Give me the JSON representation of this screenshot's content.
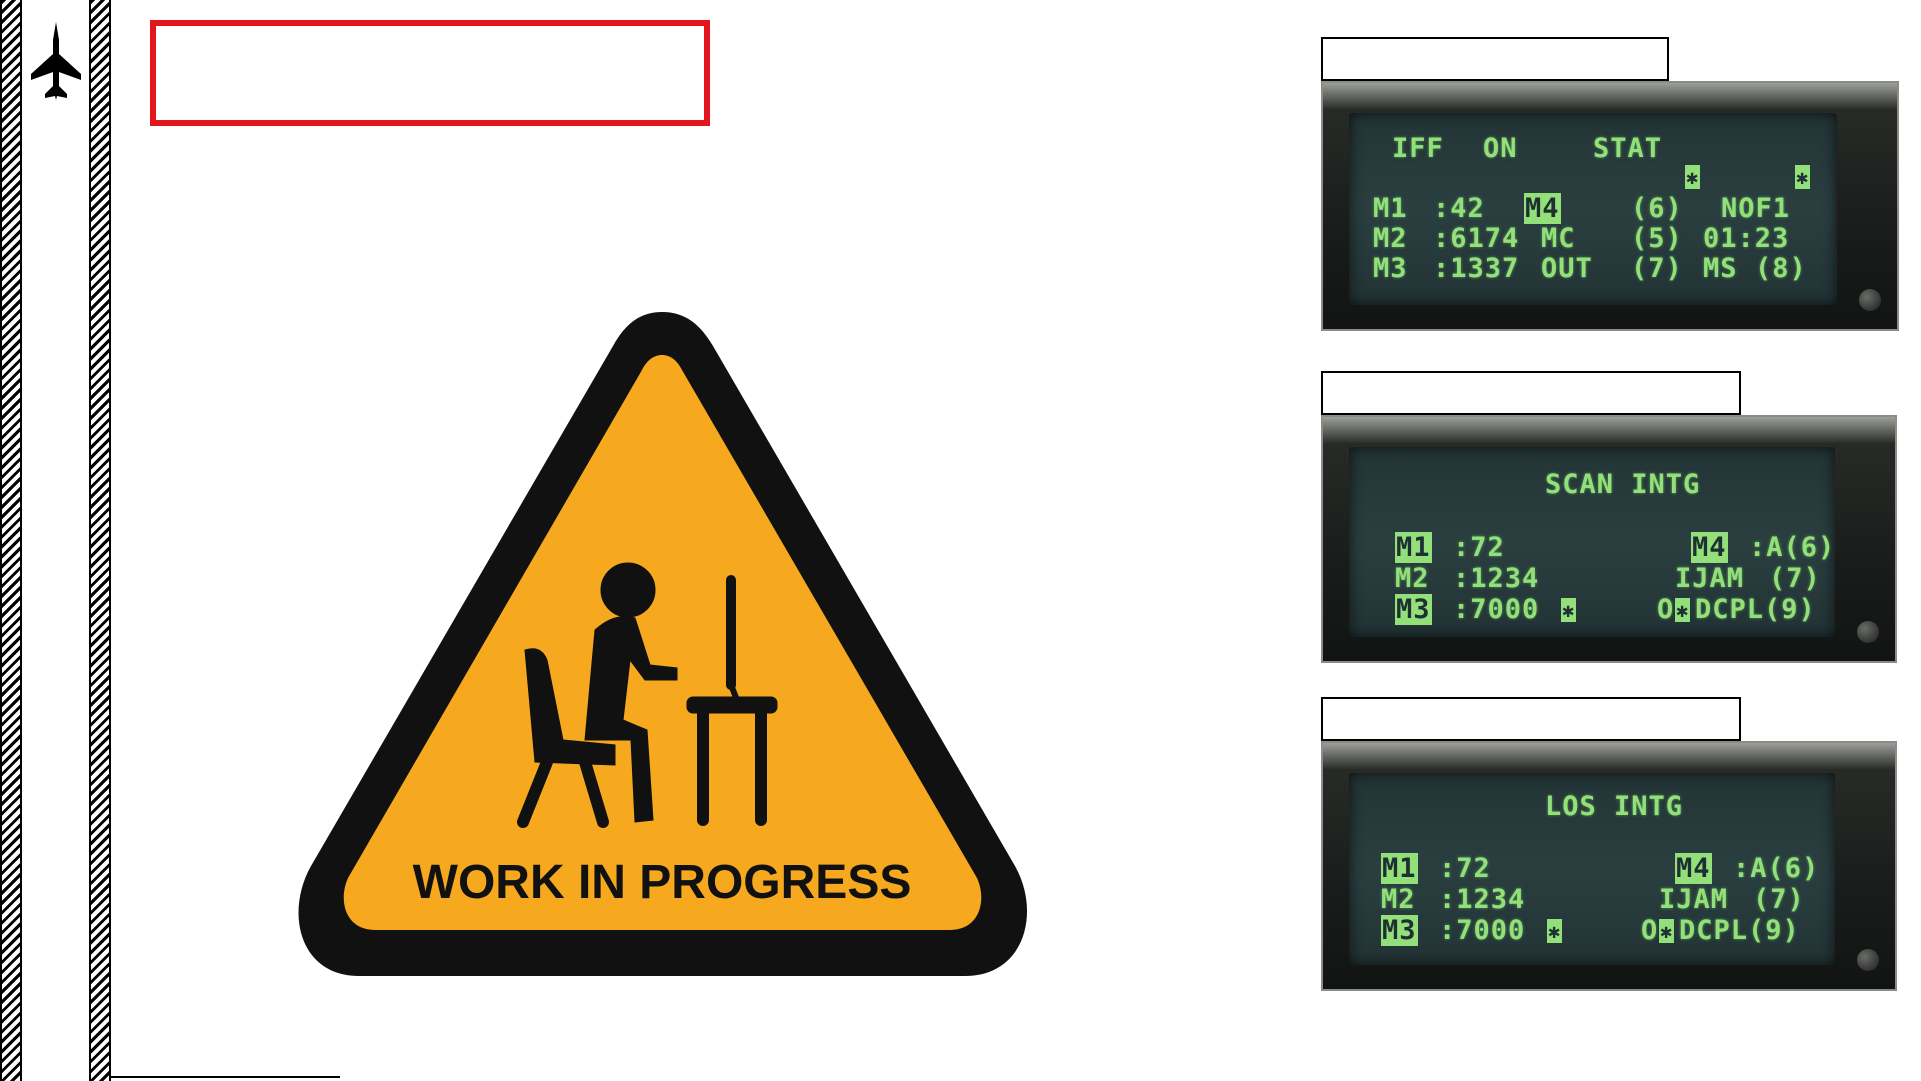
{
  "sign": {
    "text": "WORK IN PROGRESS",
    "colors": {
      "fill": "#F6A81E",
      "border": "#111111"
    }
  },
  "ded_pages": [
    {
      "id": "iff-stat",
      "rows": [
        [
          "IFF",
          "ON",
          "STAT"
        ],
        [
          "M1",
          ":42",
          "M4",
          "(6)",
          "NOF1"
        ],
        [
          "M2",
          ":6174",
          "MC",
          "(5)",
          "01:23"
        ],
        [
          "M3",
          ":1337",
          "OUT",
          "(7)",
          "MS",
          "(8)"
        ]
      ]
    },
    {
      "id": "scan-intg",
      "title": "SCAN INTG",
      "rows": [
        [
          "M1",
          ":72",
          "M4",
          ":A(6)"
        ],
        [
          "M2",
          ":1234",
          "IJAM",
          "(7)"
        ],
        [
          "M3",
          ":7000",
          "O",
          "DCPL(9)"
        ]
      ]
    },
    {
      "id": "los-intg",
      "title": "LOS INTG",
      "rows": [
        [
          "M1",
          ":72",
          "M4",
          ":A(6)"
        ],
        [
          "M2",
          ":1234",
          "IJAM",
          "(7)"
        ],
        [
          "M3",
          ":7000",
          "O",
          "DCPL(9)"
        ]
      ]
    }
  ],
  "colors": {
    "ded_text": "#93E07A",
    "title_box_border": "#E3161B"
  },
  "icons": [
    "fighter-jet-icon",
    "warning-triangle-icon",
    "person-at-computer-icon",
    "asterisk-icon"
  ]
}
